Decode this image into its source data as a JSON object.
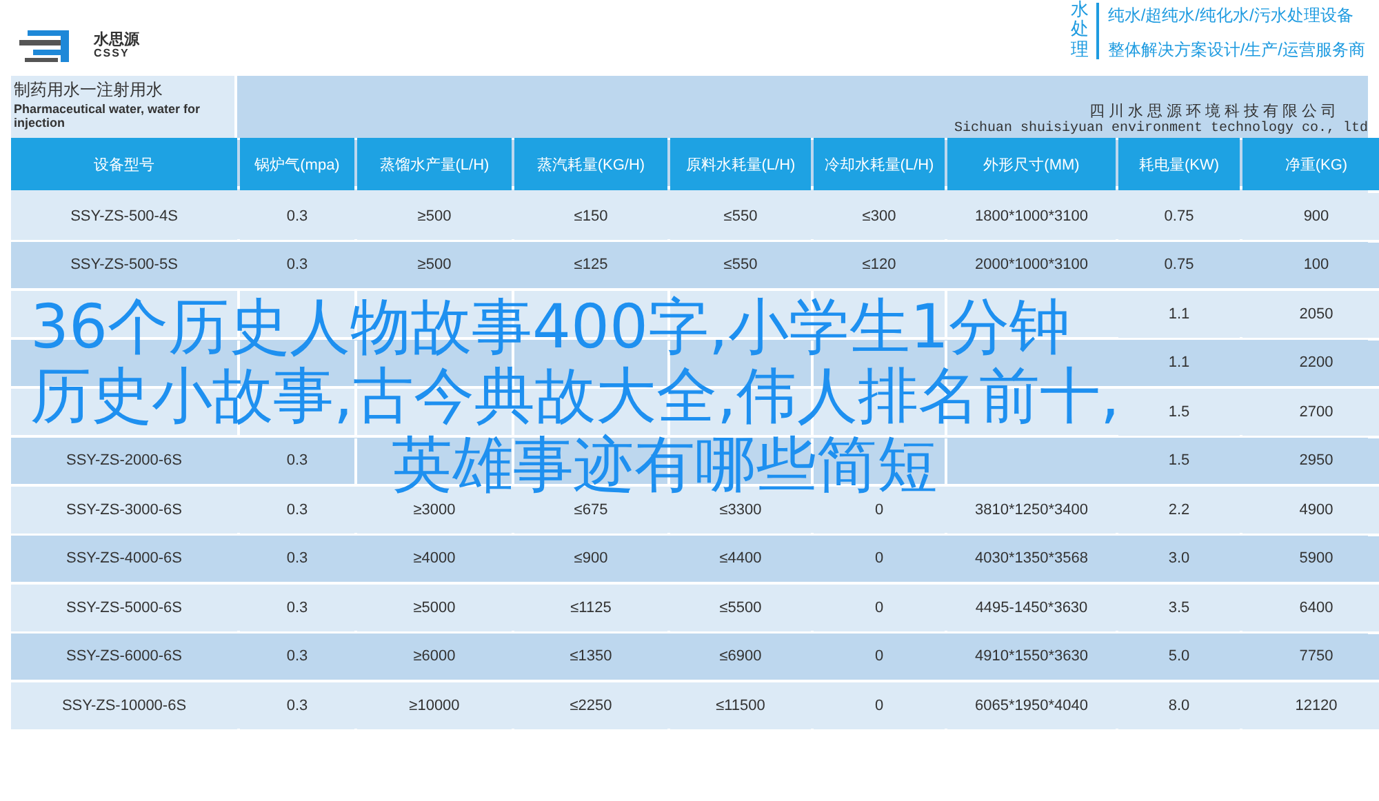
{
  "logo": {
    "name": "水思源",
    "subtitle": "CSSY"
  },
  "slogan": {
    "vertical": "水处理",
    "lines": [
      "纯水/超纯水/纯化水/污水处理设备",
      "整体解决方案设计/生产/运营服务商"
    ]
  },
  "banner": {
    "title": "制药用水一注射用水",
    "subtitle": "Pharmaceutical water, water for injection",
    "company": "四川水思源环境科技有限公司",
    "company_en": "Sichuan shuisiyuan environment technology co., ltd"
  },
  "table": {
    "columns": [
      "设备型号",
      "锅炉气(mpa)",
      "蒸馏水产量(L/H)",
      "蒸汽耗量(KG/H)",
      "原料水耗量(L/H)",
      "冷却水耗量(L/H)",
      "外形尺寸(MM)",
      "耗电量(KW)",
      "净重(KG)"
    ],
    "rows": [
      [
        "SSY-ZS-500-4S",
        "0.3",
        "≥500",
        "≤150",
        "≤550",
        "≤300",
        "1800*1000*3100",
        "0.75",
        "900"
      ],
      [
        "SSY-ZS-500-5S",
        "0.3",
        "≥500",
        "≤125",
        "≤550",
        "≤120",
        "2000*1000*3100",
        "0.75",
        "100"
      ],
      [
        null,
        null,
        null,
        null,
        null,
        null,
        null,
        "1.1",
        "2050"
      ],
      [
        null,
        null,
        null,
        null,
        null,
        null,
        null,
        "1.1",
        "2200"
      ],
      [
        null,
        null,
        null,
        null,
        null,
        null,
        null,
        "1.5",
        "2700"
      ],
      [
        "SSY-ZS-2000-6S",
        "0.3",
        null,
        null,
        null,
        null,
        null,
        "1.5",
        "2950"
      ],
      [
        "SSY-ZS-3000-6S",
        "0.3",
        "≥3000",
        "≤675",
        "≤3300",
        "0",
        "3810*1250*3400",
        "2.2",
        "4900"
      ],
      [
        "SSY-ZS-4000-6S",
        "0.3",
        "≥4000",
        "≤900",
        "≤4400",
        "0",
        "4030*1350*3568",
        "3.0",
        "5900"
      ],
      [
        "SSY-ZS-5000-6S",
        "0.3",
        "≥5000",
        "≤1125",
        "≤5500",
        "0",
        "4495-1450*3630",
        "3.5",
        "6400"
      ],
      [
        "SSY-ZS-6000-6S",
        "0.3",
        "≥6000",
        "≤1350",
        "≤6900",
        "0",
        "4910*1550*3630",
        "5.0",
        "7750"
      ],
      [
        "SSY-ZS-10000-6S",
        "0.3",
        "≥10000",
        "≤2250",
        "≤11500",
        "0",
        "6065*1950*4040",
        "8.0",
        "12120"
      ]
    ]
  },
  "headline": [
    "36个历史人物故事400字,小学生1分钟",
    "历史小故事,古今典故大全,伟人排名前十,",
    "英雄事迹有哪些简短"
  ]
}
